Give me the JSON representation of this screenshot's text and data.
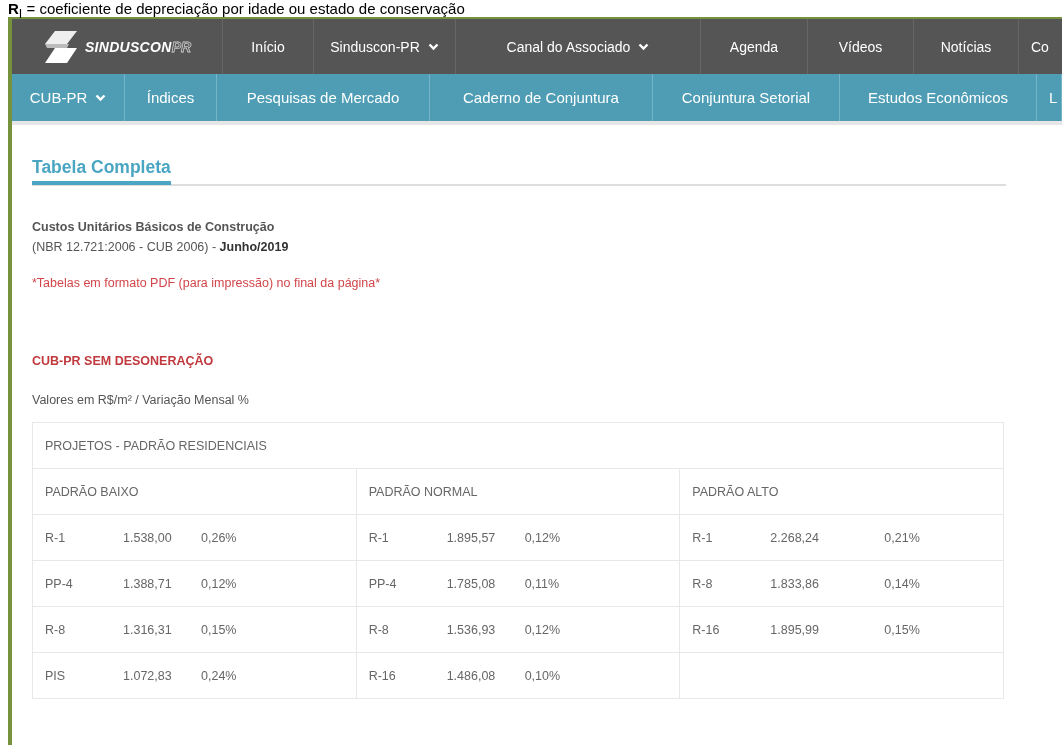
{
  "caption": "**R**$_{I}$ = coeficiente de depreciação por idade ou estado de conservação",
  "logo": {
    "name": "SINDUSCON",
    "suffix": "PR"
  },
  "main_nav": [
    {
      "label": "Início",
      "dropdown": false
    },
    {
      "label": "Sinduscon-PR",
      "dropdown": true
    },
    {
      "label": "Canal do Associado",
      "dropdown": true
    },
    {
      "label": "Agenda",
      "dropdown": false
    },
    {
      "label": "Vídeos",
      "dropdown": false
    },
    {
      "label": "Notícias",
      "dropdown": false
    },
    {
      "label": "Co"
    }
  ],
  "sub_nav": [
    {
      "label": "CUB-PR",
      "dropdown": true
    },
    {
      "label": "Índices",
      "dropdown": false
    },
    {
      "label": "Pesquisas de Mercado",
      "dropdown": false
    },
    {
      "label": "Caderno de Conjuntura",
      "dropdown": false
    },
    {
      "label": "Conjuntura Setorial",
      "dropdown": false
    },
    {
      "label": "Estudos Econômicos",
      "dropdown": false
    },
    {
      "label": "L"
    }
  ],
  "page_title": "Tabela Completa",
  "subtitle": "Custos Unitários Básicos de Construção",
  "standard": "(NBR 12.721:2006 - CUB 2006) - **Junho/2019**",
  "pdf_note": "*Tabelas em formato PDF (para impressão) no final da página*",
  "section_title": "CUB-PR SEM DESONERAÇÃO",
  "units_note": "Valores em R$/m² / Variação Mensal %",
  "table": {
    "title": "PROJETOS - PADRÃO RESIDENCIAIS",
    "groups": [
      {
        "heading": "PADRÃO BAIXO",
        "rows": [
          {
            "code": "R-1",
            "value": "1.538,00",
            "change": "0,26%"
          },
          {
            "code": "PP-4",
            "value": "1.388,71",
            "change": "0,12%"
          },
          {
            "code": "R-8",
            "value": "1.316,31",
            "change": "0,15%"
          },
          {
            "code": "PIS",
            "value": "1.072,83",
            "change": "0,24%"
          }
        ]
      },
      {
        "heading": "PADRÃO NORMAL",
        "rows": [
          {
            "code": "R-1",
            "value": "1.895,57",
            "change": "0,12%"
          },
          {
            "code": "PP-4",
            "value": "1.785,08",
            "change": "0,11%"
          },
          {
            "code": "R-8",
            "value": "1.536,93",
            "change": "0,12%"
          },
          {
            "code": "R-16",
            "value": "1.486,08",
            "change": "0,10%"
          }
        ]
      },
      {
        "heading": "PADRÃO ALTO",
        "rows": [
          {
            "code": "R-1",
            "value": "2.268,24",
            "change": "0,21%"
          },
          {
            "code": "R-8",
            "value": "1.833,86",
            "change": "0,14%"
          },
          {
            "code": "R-16",
            "value": "1.895,99",
            "change": "0,15%"
          }
        ]
      }
    ]
  }
}
